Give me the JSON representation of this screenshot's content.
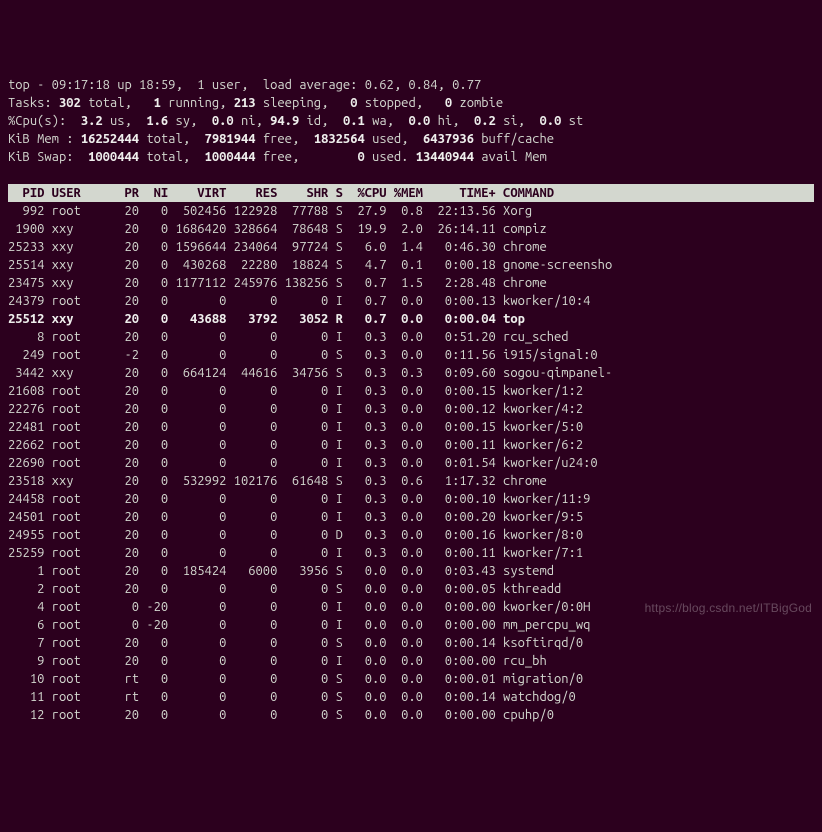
{
  "summary": {
    "l1": "top - 09:17:18 up 18:59,  1 user,  load average: 0.62, 0.84, 0.77",
    "l2a": "Tasks: ",
    "l2b": "302 ",
    "l2c": "total,   ",
    "l2d": "1 ",
    "l2e": "running, ",
    "l2f": "213 ",
    "l2g": "sleeping,   ",
    "l2h": "0 ",
    "l2i": "stopped,   ",
    "l2j": "0 ",
    "l2k": "zombie",
    "l3a": "%Cpu(s):  ",
    "l3b": "3.2 ",
    "l3c": "us,  ",
    "l3d": "1.6 ",
    "l3e": "sy,  ",
    "l3f": "0.0 ",
    "l3g": "ni, ",
    "l3h": "94.9 ",
    "l3i": "id,  ",
    "l3j": "0.1 ",
    "l3k": "wa,  ",
    "l3l": "0.0 ",
    "l3m": "hi,  ",
    "l3n": "0.2 ",
    "l3o": "si,  ",
    "l3p": "0.0 ",
    "l3q": "st",
    "l4a": "KiB Mem : ",
    "l4b": "16252444 ",
    "l4c": "total,  ",
    "l4d": "7981944 ",
    "l4e": "free,  ",
    "l4f": "1832564 ",
    "l4g": "used,  ",
    "l4h": "6437936 ",
    "l4i": "buff/cache",
    "l5a": "KiB Swap:  ",
    "l5b": "1000444 ",
    "l5c": "total,  ",
    "l5d": "1000444 ",
    "l5e": "free,        ",
    "l5f": "0 ",
    "l5g": "used. ",
    "l5h": "13440944 ",
    "l5i": "avail Mem"
  },
  "header": "  PID USER      PR  NI    VIRT    RES    SHR S  %CPU %MEM     TIME+ COMMAND          ",
  "rows": [
    {
      "pid": "992",
      "user": "root",
      "pr": "20",
      "ni": "0",
      "virt": "502456",
      "res": "122928",
      "shr": "77788",
      "s": "S",
      "cpu": "27.9",
      "mem": "0.8",
      "time": "22:13.56",
      "cmd": "Xorg",
      "bold": false
    },
    {
      "pid": "1900",
      "user": "xxy",
      "pr": "20",
      "ni": "0",
      "virt": "1686420",
      "res": "328664",
      "shr": "78648",
      "s": "S",
      "cpu": "19.9",
      "mem": "2.0",
      "time": "26:14.11",
      "cmd": "compiz",
      "bold": false
    },
    {
      "pid": "25233",
      "user": "xxy",
      "pr": "20",
      "ni": "0",
      "virt": "1596644",
      "res": "234064",
      "shr": "97724",
      "s": "S",
      "cpu": "6.0",
      "mem": "1.4",
      "time": "0:46.30",
      "cmd": "chrome",
      "bold": false
    },
    {
      "pid": "25514",
      "user": "xxy",
      "pr": "20",
      "ni": "0",
      "virt": "430268",
      "res": "22280",
      "shr": "18824",
      "s": "S",
      "cpu": "4.7",
      "mem": "0.1",
      "time": "0:00.18",
      "cmd": "gnome-screensho",
      "bold": false
    },
    {
      "pid": "23475",
      "user": "xxy",
      "pr": "20",
      "ni": "0",
      "virt": "1177112",
      "res": "245976",
      "shr": "138256",
      "s": "S",
      "cpu": "0.7",
      "mem": "1.5",
      "time": "2:28.48",
      "cmd": "chrome",
      "bold": false
    },
    {
      "pid": "24379",
      "user": "root",
      "pr": "20",
      "ni": "0",
      "virt": "0",
      "res": "0",
      "shr": "0",
      "s": "I",
      "cpu": "0.7",
      "mem": "0.0",
      "time": "0:00.13",
      "cmd": "kworker/10:4",
      "bold": false
    },
    {
      "pid": "25512",
      "user": "xxy",
      "pr": "20",
      "ni": "0",
      "virt": "43688",
      "res": "3792",
      "shr": "3052",
      "s": "R",
      "cpu": "0.7",
      "mem": "0.0",
      "time": "0:00.04",
      "cmd": "top",
      "bold": true
    },
    {
      "pid": "8",
      "user": "root",
      "pr": "20",
      "ni": "0",
      "virt": "0",
      "res": "0",
      "shr": "0",
      "s": "I",
      "cpu": "0.3",
      "mem": "0.0",
      "time": "0:51.20",
      "cmd": "rcu_sched",
      "bold": false
    },
    {
      "pid": "249",
      "user": "root",
      "pr": "-2",
      "ni": "0",
      "virt": "0",
      "res": "0",
      "shr": "0",
      "s": "S",
      "cpu": "0.3",
      "mem": "0.0",
      "time": "0:11.56",
      "cmd": "i915/signal:0",
      "bold": false
    },
    {
      "pid": "3442",
      "user": "xxy",
      "pr": "20",
      "ni": "0",
      "virt": "664124",
      "res": "44616",
      "shr": "34756",
      "s": "S",
      "cpu": "0.3",
      "mem": "0.3",
      "time": "0:09.60",
      "cmd": "sogou-qimpanel-",
      "bold": false
    },
    {
      "pid": "21608",
      "user": "root",
      "pr": "20",
      "ni": "0",
      "virt": "0",
      "res": "0",
      "shr": "0",
      "s": "I",
      "cpu": "0.3",
      "mem": "0.0",
      "time": "0:00.15",
      "cmd": "kworker/1:2",
      "bold": false
    },
    {
      "pid": "22276",
      "user": "root",
      "pr": "20",
      "ni": "0",
      "virt": "0",
      "res": "0",
      "shr": "0",
      "s": "I",
      "cpu": "0.3",
      "mem": "0.0",
      "time": "0:00.12",
      "cmd": "kworker/4:2",
      "bold": false
    },
    {
      "pid": "22481",
      "user": "root",
      "pr": "20",
      "ni": "0",
      "virt": "0",
      "res": "0",
      "shr": "0",
      "s": "I",
      "cpu": "0.3",
      "mem": "0.0",
      "time": "0:00.15",
      "cmd": "kworker/5:0",
      "bold": false
    },
    {
      "pid": "22662",
      "user": "root",
      "pr": "20",
      "ni": "0",
      "virt": "0",
      "res": "0",
      "shr": "0",
      "s": "I",
      "cpu": "0.3",
      "mem": "0.0",
      "time": "0:00.11",
      "cmd": "kworker/6:2",
      "bold": false
    },
    {
      "pid": "22690",
      "user": "root",
      "pr": "20",
      "ni": "0",
      "virt": "0",
      "res": "0",
      "shr": "0",
      "s": "I",
      "cpu": "0.3",
      "mem": "0.0",
      "time": "0:01.54",
      "cmd": "kworker/u24:0",
      "bold": false
    },
    {
      "pid": "23518",
      "user": "xxy",
      "pr": "20",
      "ni": "0",
      "virt": "532992",
      "res": "102176",
      "shr": "61648",
      "s": "S",
      "cpu": "0.3",
      "mem": "0.6",
      "time": "1:17.32",
      "cmd": "chrome",
      "bold": false
    },
    {
      "pid": "24458",
      "user": "root",
      "pr": "20",
      "ni": "0",
      "virt": "0",
      "res": "0",
      "shr": "0",
      "s": "I",
      "cpu": "0.3",
      "mem": "0.0",
      "time": "0:00.10",
      "cmd": "kworker/11:9",
      "bold": false
    },
    {
      "pid": "24501",
      "user": "root",
      "pr": "20",
      "ni": "0",
      "virt": "0",
      "res": "0",
      "shr": "0",
      "s": "I",
      "cpu": "0.3",
      "mem": "0.0",
      "time": "0:00.20",
      "cmd": "kworker/9:5",
      "bold": false
    },
    {
      "pid": "24955",
      "user": "root",
      "pr": "20",
      "ni": "0",
      "virt": "0",
      "res": "0",
      "shr": "0",
      "s": "D",
      "cpu": "0.3",
      "mem": "0.0",
      "time": "0:00.16",
      "cmd": "kworker/8:0",
      "bold": false
    },
    {
      "pid": "25259",
      "user": "root",
      "pr": "20",
      "ni": "0",
      "virt": "0",
      "res": "0",
      "shr": "0",
      "s": "I",
      "cpu": "0.3",
      "mem": "0.0",
      "time": "0:00.11",
      "cmd": "kworker/7:1",
      "bold": false
    },
    {
      "pid": "1",
      "user": "root",
      "pr": "20",
      "ni": "0",
      "virt": "185424",
      "res": "6000",
      "shr": "3956",
      "s": "S",
      "cpu": "0.0",
      "mem": "0.0",
      "time": "0:03.43",
      "cmd": "systemd",
      "bold": false
    },
    {
      "pid": "2",
      "user": "root",
      "pr": "20",
      "ni": "0",
      "virt": "0",
      "res": "0",
      "shr": "0",
      "s": "S",
      "cpu": "0.0",
      "mem": "0.0",
      "time": "0:00.05",
      "cmd": "kthreadd",
      "bold": false
    },
    {
      "pid": "4",
      "user": "root",
      "pr": "0",
      "ni": "-20",
      "virt": "0",
      "res": "0",
      "shr": "0",
      "s": "I",
      "cpu": "0.0",
      "mem": "0.0",
      "time": "0:00.00",
      "cmd": "kworker/0:0H",
      "bold": false
    },
    {
      "pid": "6",
      "user": "root",
      "pr": "0",
      "ni": "-20",
      "virt": "0",
      "res": "0",
      "shr": "0",
      "s": "I",
      "cpu": "0.0",
      "mem": "0.0",
      "time": "0:00.00",
      "cmd": "mm_percpu_wq",
      "bold": false
    },
    {
      "pid": "7",
      "user": "root",
      "pr": "20",
      "ni": "0",
      "virt": "0",
      "res": "0",
      "shr": "0",
      "s": "S",
      "cpu": "0.0",
      "mem": "0.0",
      "time": "0:00.14",
      "cmd": "ksoftirqd/0",
      "bold": false
    },
    {
      "pid": "9",
      "user": "root",
      "pr": "20",
      "ni": "0",
      "virt": "0",
      "res": "0",
      "shr": "0",
      "s": "I",
      "cpu": "0.0",
      "mem": "0.0",
      "time": "0:00.00",
      "cmd": "rcu_bh",
      "bold": false
    },
    {
      "pid": "10",
      "user": "root",
      "pr": "rt",
      "ni": "0",
      "virt": "0",
      "res": "0",
      "shr": "0",
      "s": "S",
      "cpu": "0.0",
      "mem": "0.0",
      "time": "0:00.01",
      "cmd": "migration/0",
      "bold": false
    },
    {
      "pid": "11",
      "user": "root",
      "pr": "rt",
      "ni": "0",
      "virt": "0",
      "res": "0",
      "shr": "0",
      "s": "S",
      "cpu": "0.0",
      "mem": "0.0",
      "time": "0:00.14",
      "cmd": "watchdog/0",
      "bold": false
    },
    {
      "pid": "12",
      "user": "root",
      "pr": "20",
      "ni": "0",
      "virt": "0",
      "res": "0",
      "shr": "0",
      "s": "S",
      "cpu": "0.0",
      "mem": "0.0",
      "time": "0:00.00",
      "cmd": "cpuhp/0",
      "bold": false
    }
  ],
  "watermark": "https://blog.csdn.net/ITBigGod"
}
